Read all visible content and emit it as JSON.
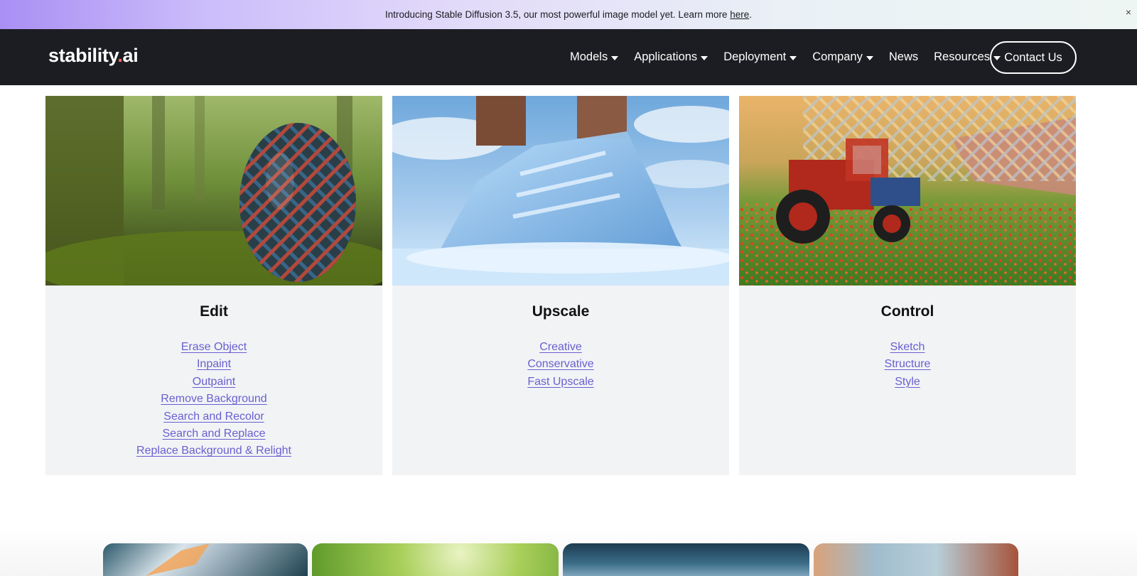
{
  "banner": {
    "text": "Introducing Stable Diffusion 3.5, our most powerful image model yet. Learn more ",
    "link": "here",
    "end": ".",
    "close": "×"
  },
  "nav": {
    "logo_main": "stability",
    "logo_dot": ".",
    "logo_ai": "ai",
    "items": [
      {
        "label": "Models",
        "dropdown": true
      },
      {
        "label": "Applications",
        "dropdown": true
      },
      {
        "label": "Deployment",
        "dropdown": true
      },
      {
        "label": "Company",
        "dropdown": true
      },
      {
        "label": "News",
        "dropdown": false
      },
      {
        "label": "Resources",
        "dropdown": true
      }
    ],
    "contact": "Contact Us"
  },
  "cards": [
    {
      "title": "Edit",
      "links": [
        "Erase Object",
        "Inpaint ",
        "Outpaint",
        "Remove Background",
        "Search and Recolor",
        "Search and Replace",
        "Replace Background & Relight"
      ]
    },
    {
      "title": "Upscale",
      "links": [
        "Creative",
        "Conservative",
        "Fast Upscale"
      ]
    },
    {
      "title": "Control",
      "links": [
        "Sketch",
        "Structure",
        "Style"
      ]
    }
  ],
  "colors": {
    "nav_bg": "#1c1d22",
    "card_bg": "#f1f3f5",
    "link": "#6a5fd0",
    "logo_accent": "#ff6b57"
  }
}
